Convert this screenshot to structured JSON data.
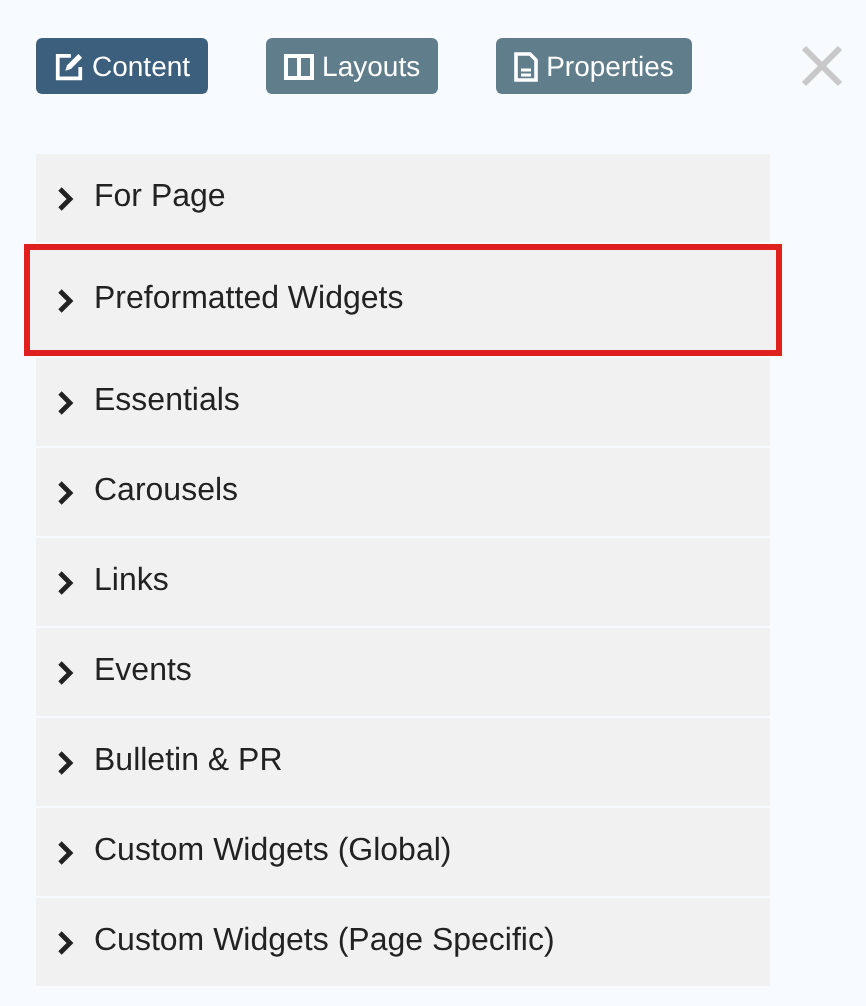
{
  "tabs": [
    {
      "label": "Content",
      "kind": "edit",
      "selected": true
    },
    {
      "label": "Layouts",
      "kind": "columns",
      "selected": false
    },
    {
      "label": "Properties",
      "kind": "file",
      "selected": false
    }
  ],
  "items": [
    {
      "label": "For Page",
      "highlighted": false
    },
    {
      "label": "Preformatted Widgets",
      "highlighted": true
    },
    {
      "label": "Essentials",
      "highlighted": false
    },
    {
      "label": "Carousels",
      "highlighted": false
    },
    {
      "label": "Links",
      "highlighted": false
    },
    {
      "label": "Events",
      "highlighted": false
    },
    {
      "label": "Bulletin & PR",
      "highlighted": false
    },
    {
      "label": "Custom Widgets (Global)",
      "highlighted": false
    },
    {
      "label": "Custom Widgets (Page Specific)",
      "highlighted": false
    }
  ]
}
